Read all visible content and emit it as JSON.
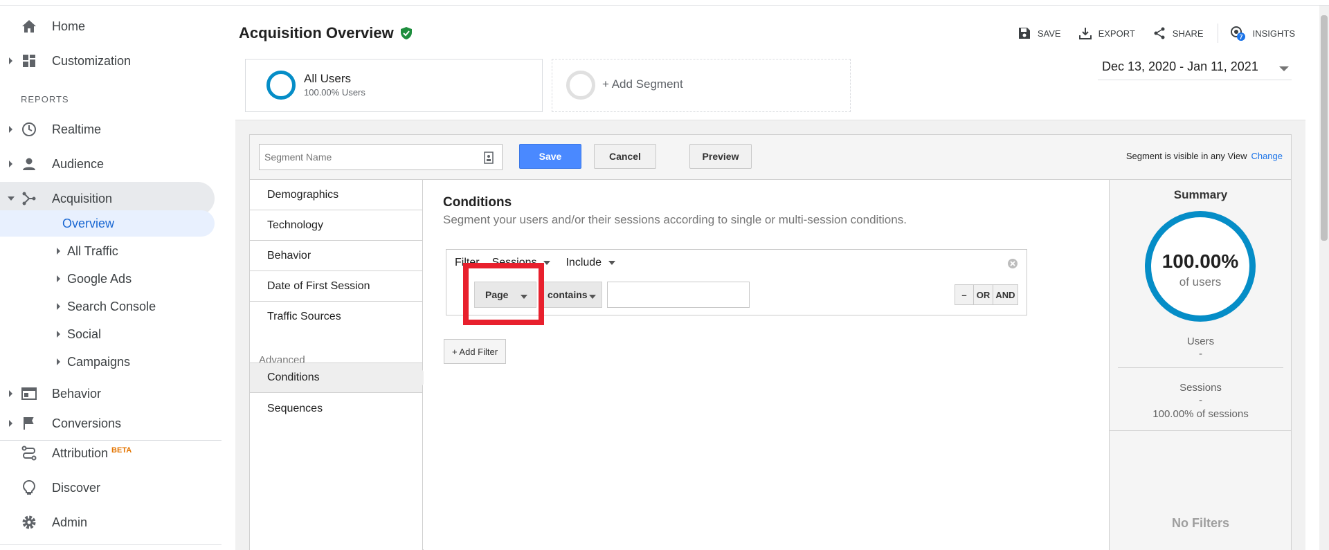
{
  "sidebar": {
    "home": "Home",
    "customization": "Customization",
    "reports_header": "REPORTS",
    "realtime": "Realtime",
    "audience": "Audience",
    "acquisition": "Acquisition",
    "sub": {
      "overview": "Overview",
      "all_traffic": "All Traffic",
      "google_ads": "Google Ads",
      "search_console": "Search Console",
      "social": "Social",
      "campaigns": "Campaigns"
    },
    "behavior": "Behavior",
    "conversions": "Conversions",
    "attribution": "Attribution",
    "attribution_badge": "BETA",
    "discover": "Discover",
    "admin": "Admin"
  },
  "header": {
    "title": "Acquisition Overview",
    "save": "SAVE",
    "export": "EXPORT",
    "share": "SHARE",
    "insights": "INSIGHTS",
    "insights_count": "7"
  },
  "segments": {
    "all_users": "All Users",
    "all_users_sub": "100.00% Users",
    "add_segment": "+ Add Segment",
    "date_range": "Dec 13, 2020 - Jan 11, 2021"
  },
  "editor": {
    "segment_name_placeholder": "Segment Name",
    "save": "Save",
    "cancel": "Cancel",
    "preview": "Preview",
    "visibility_text": "Segment is visible in any View",
    "change_link": "Change",
    "categories": [
      "Demographics",
      "Technology",
      "Behavior",
      "Date of First Session",
      "Traffic Sources"
    ],
    "advanced_header": "Advanced",
    "advanced": [
      "Conditions",
      "Sequences"
    ],
    "conditions_title": "Conditions",
    "conditions_desc": "Segment your users and/or their sessions according to single or multi-session conditions.",
    "filter_label": "Filter",
    "filter_scope": "Sessions",
    "filter_mode": "Include",
    "dimension": "Page",
    "operator": "contains",
    "value": "",
    "minus": "–",
    "or": "OR",
    "and": "AND",
    "add_filter": "+ Add Filter"
  },
  "summary": {
    "title": "Summary",
    "percent": "100.00%",
    "percent_sub": "of users",
    "users_label": "Users",
    "users_value": "-",
    "sessions_label": "Sessions",
    "sessions_value": "-",
    "sessions_pct": "100.00% of sessions",
    "no_filters": "No Filters"
  },
  "colors": {
    "accent": "#058dc7",
    "primary_button": "#4a89ff",
    "highlight": "#e8202d",
    "verified": "#1e8e3e"
  }
}
